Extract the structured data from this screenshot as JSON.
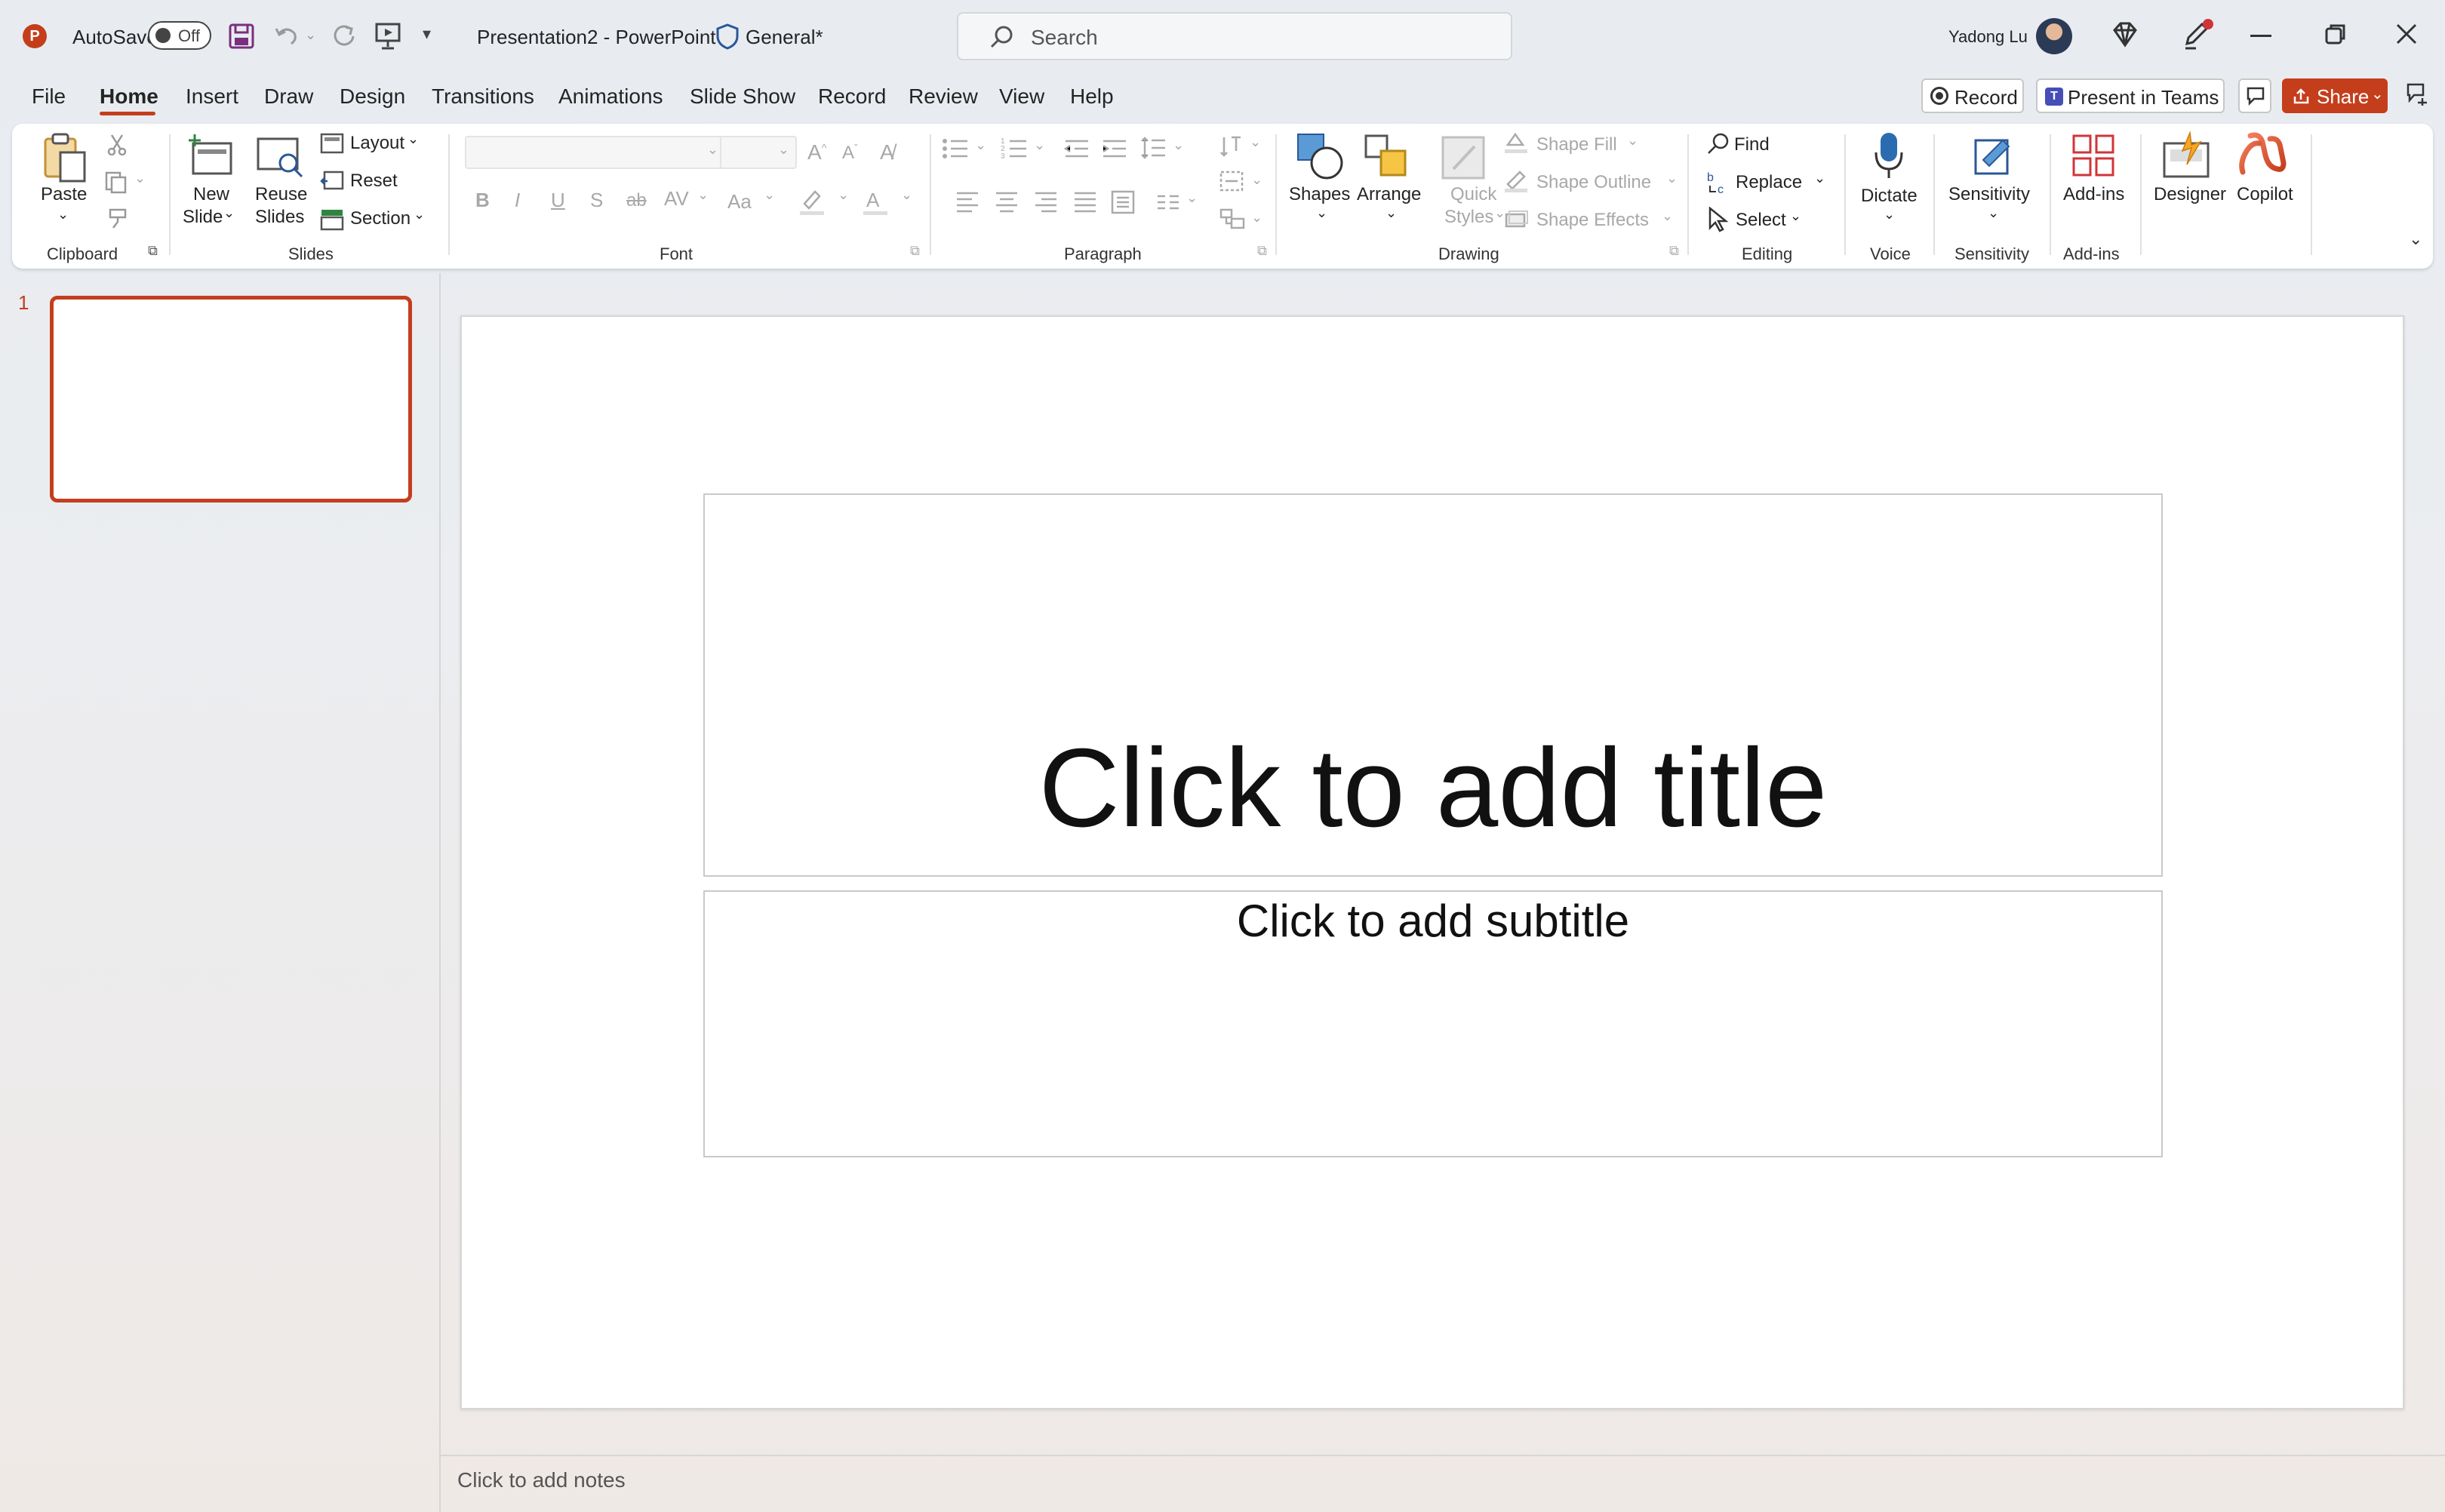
{
  "titlebar": {
    "autosave_label": "AutoSave",
    "autosave_state": "Off",
    "document_title": "Presentation2  -  PowerPoint",
    "sensitivity_label": "General*",
    "search_placeholder": "Search",
    "user_name": "Yadong Lu"
  },
  "tabs": [
    "File",
    "Home",
    "Insert",
    "Draw",
    "Design",
    "Transitions",
    "Animations",
    "Slide Show",
    "Record",
    "Review",
    "View",
    "Help"
  ],
  "active_tab": "Home",
  "tab_actions": {
    "record": "Record",
    "present_in_teams": "Present in Teams",
    "share": "Share"
  },
  "ribbon": {
    "clipboard": {
      "paste": "Paste",
      "group_label": "Clipboard"
    },
    "slides": {
      "new_slide_1": "New",
      "new_slide_2": "Slide",
      "reuse_1": "Reuse",
      "reuse_2": "Slides",
      "layout": "Layout",
      "reset": "Reset",
      "section": "Section",
      "group_label": "Slides"
    },
    "font": {
      "group_label": "Font",
      "bold": "B",
      "italic": "I",
      "underline": "U",
      "shadow": "S",
      "strike": "ab",
      "spacing": "AV",
      "case": "Aa"
    },
    "paragraph": {
      "group_label": "Paragraph"
    },
    "drawing": {
      "shapes": "Shapes",
      "arrange": "Arrange",
      "quick_1": "Quick",
      "quick_2": "Styles",
      "shape_fill": "Shape Fill",
      "shape_outline": "Shape Outline",
      "shape_effects": "Shape Effects",
      "group_label": "Drawing"
    },
    "editing": {
      "find": "Find",
      "replace": "Replace",
      "select": "Select",
      "group_label": "Editing"
    },
    "voice": {
      "dictate": "Dictate",
      "group_label": "Voice"
    },
    "sensitivity": {
      "sensitivity": "Sensitivity",
      "group_label": "Sensitivity"
    },
    "addins": {
      "addins": "Add-ins",
      "group_label": "Add-ins"
    },
    "designer": "Designer",
    "copilot": "Copilot"
  },
  "slide_panel": {
    "slide_number": "1"
  },
  "slide": {
    "title_placeholder": "Click to add title",
    "subtitle_placeholder": "Click to add subtitle"
  },
  "notes_placeholder": "Click to add notes",
  "colors": {
    "accent": "#c43e1c",
    "share_button": "#c43e1c"
  }
}
